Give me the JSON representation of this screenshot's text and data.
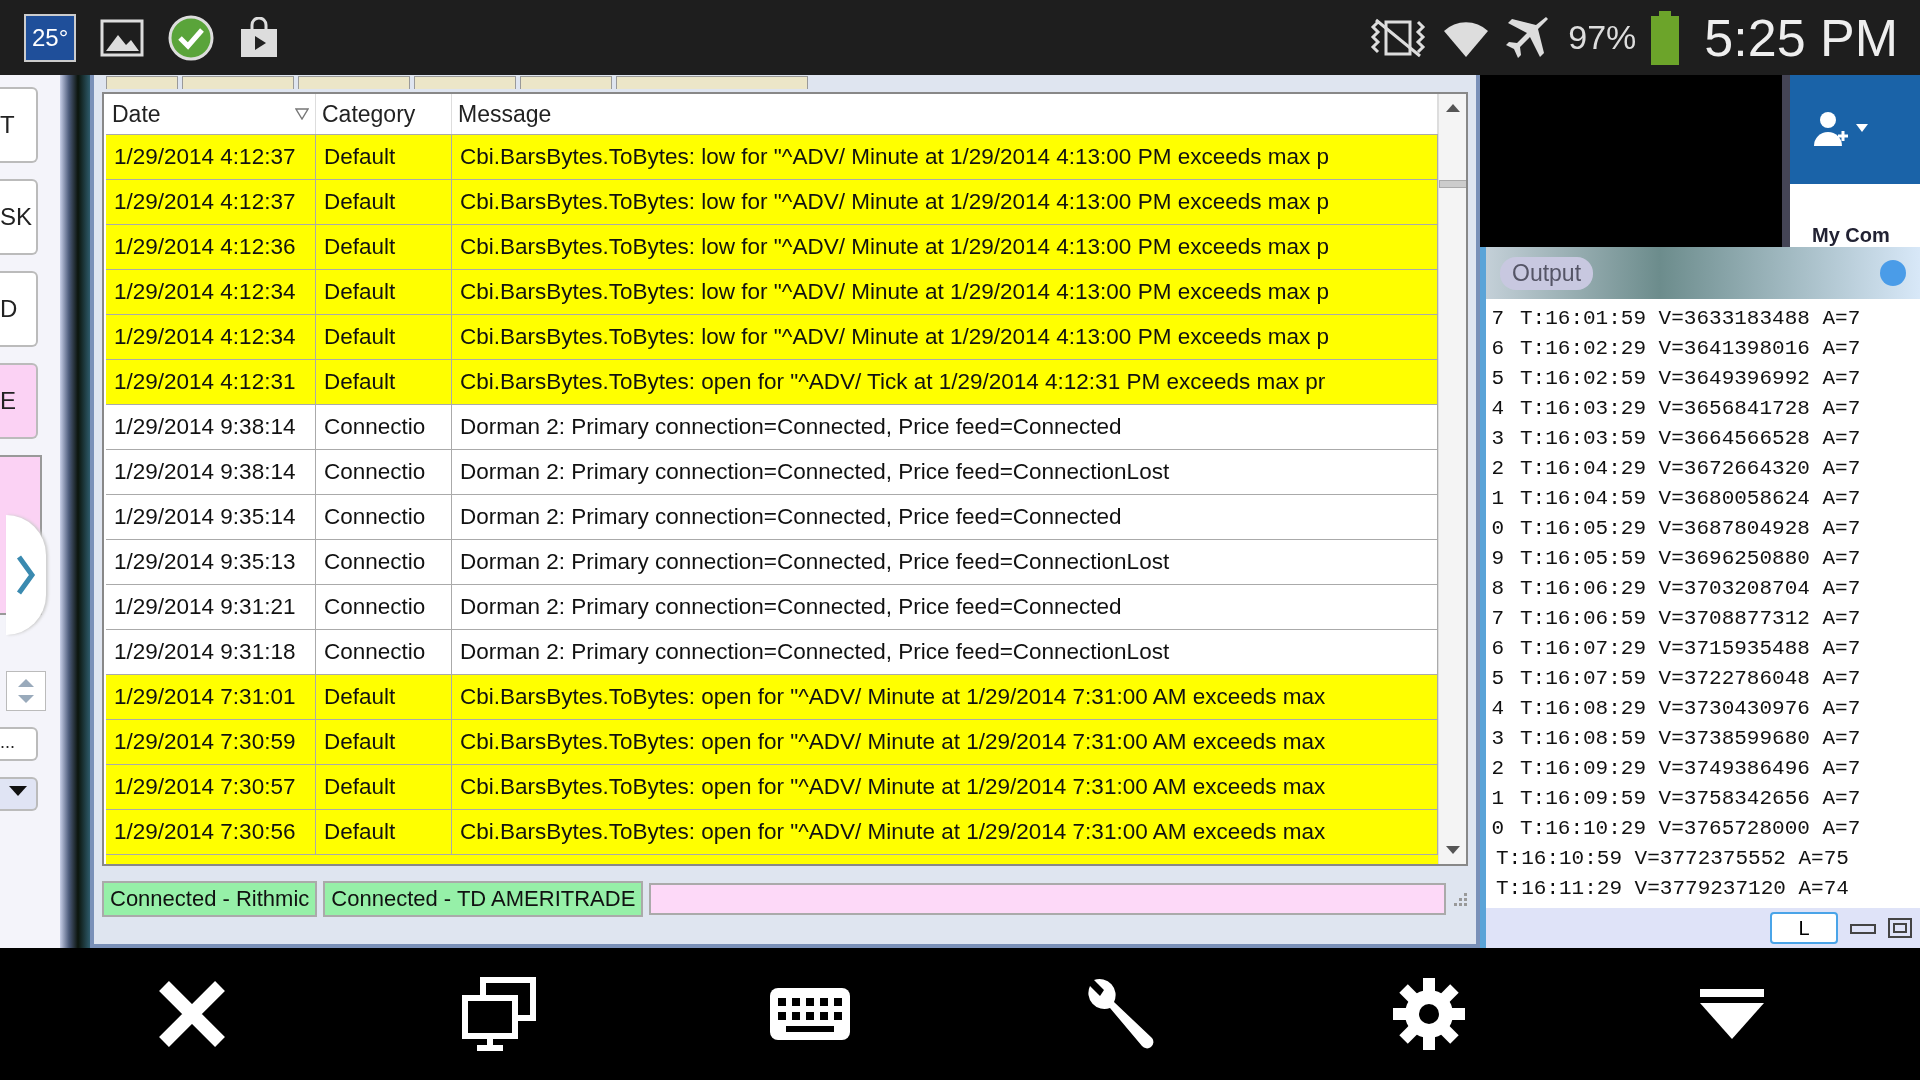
{
  "status_bar": {
    "temperature": "25°",
    "battery_percent": "97%",
    "time": "5:25 PM"
  },
  "left_panel": {
    "buttons": [
      {
        "label": "T",
        "kind": "plain"
      },
      {
        "label": "SK",
        "kind": "plain"
      },
      {
        "label": "D",
        "kind": "plain"
      },
      {
        "label": "E",
        "kind": "pink"
      }
    ],
    "ellipsis": "..."
  },
  "log_table": {
    "columns": [
      "Date",
      "Category",
      "Message"
    ],
    "rows": [
      {
        "date": "1/29/2014 4:12:37",
        "category": "Default",
        "message": "Cbi.BarsBytes.ToBytes: low for \"^ADV/ Minute at 1/29/2014 4:13:00 PM exceeds max p",
        "highlighted": true
      },
      {
        "date": "1/29/2014 4:12:37",
        "category": "Default",
        "message": "Cbi.BarsBytes.ToBytes: low for \"^ADV/ Minute at 1/29/2014 4:13:00 PM exceeds max p",
        "highlighted": true
      },
      {
        "date": "1/29/2014 4:12:36",
        "category": "Default",
        "message": "Cbi.BarsBytes.ToBytes: low for \"^ADV/ Minute at 1/29/2014 4:13:00 PM exceeds max p",
        "highlighted": true
      },
      {
        "date": "1/29/2014 4:12:34",
        "category": "Default",
        "message": "Cbi.BarsBytes.ToBytes: low for \"^ADV/ Minute at 1/29/2014 4:13:00 PM exceeds max p",
        "highlighted": true
      },
      {
        "date": "1/29/2014 4:12:34",
        "category": "Default",
        "message": "Cbi.BarsBytes.ToBytes: low for \"^ADV/ Minute at 1/29/2014 4:13:00 PM exceeds max p",
        "highlighted": true
      },
      {
        "date": "1/29/2014 4:12:31",
        "category": "Default",
        "message": "Cbi.BarsBytes.ToBytes: open for \"^ADV/ Tick at 1/29/2014 4:12:31 PM exceeds max pr",
        "highlighted": true
      },
      {
        "date": "1/29/2014 9:38:14",
        "category": "Connectio",
        "message": "Dorman 2: Primary connection=Connected, Price feed=Connected",
        "highlighted": false
      },
      {
        "date": "1/29/2014 9:38:14",
        "category": "Connectio",
        "message": "Dorman 2: Primary connection=Connected, Price feed=ConnectionLost",
        "highlighted": false
      },
      {
        "date": "1/29/2014 9:35:14",
        "category": "Connectio",
        "message": "Dorman 2: Primary connection=Connected, Price feed=Connected",
        "highlighted": false
      },
      {
        "date": "1/29/2014 9:35:13",
        "category": "Connectio",
        "message": "Dorman 2: Primary connection=Connected, Price feed=ConnectionLost",
        "highlighted": false
      },
      {
        "date": "1/29/2014 9:31:21",
        "category": "Connectio",
        "message": "Dorman 2: Primary connection=Connected, Price feed=Connected",
        "highlighted": false
      },
      {
        "date": "1/29/2014 9:31:18",
        "category": "Connectio",
        "message": "Dorman 2: Primary connection=Connected, Price feed=ConnectionLost",
        "highlighted": false
      },
      {
        "date": "1/29/2014 7:31:01",
        "category": "Default",
        "message": "Cbi.BarsBytes.ToBytes: open for \"^ADV/ Minute at 1/29/2014 7:31:00 AM exceeds max",
        "highlighted": true
      },
      {
        "date": "1/29/2014 7:30:59",
        "category": "Default",
        "message": "Cbi.BarsBytes.ToBytes: open for \"^ADV/ Minute at 1/29/2014 7:31:00 AM exceeds max",
        "highlighted": true
      },
      {
        "date": "1/29/2014 7:30:57",
        "category": "Default",
        "message": "Cbi.BarsBytes.ToBytes: open for \"^ADV/ Minute at 1/29/2014 7:31:00 AM exceeds max",
        "highlighted": true
      },
      {
        "date": "1/29/2014 7:30:56",
        "category": "Default",
        "message": "Cbi.BarsBytes.ToBytes: open for \"^ADV/ Minute at 1/29/2014 7:31:00 AM exceeds max",
        "highlighted": true
      }
    ]
  },
  "connections": [
    "Connected - Rithmic",
    "Connected - TD AMERITRADE"
  ],
  "side_panel": {
    "heading": "My Com"
  },
  "output": {
    "title": "Output",
    "lines": [
      {
        "prefix": "7",
        "text": "T:16:01:59 V=3633183488 A=7"
      },
      {
        "prefix": "6",
        "text": "T:16:02:29 V=3641398016 A=7"
      },
      {
        "prefix": "5",
        "text": "T:16:02:59 V=3649396992 A=7"
      },
      {
        "prefix": "4",
        "text": "T:16:03:29 V=3656841728 A=7"
      },
      {
        "prefix": "3",
        "text": "T:16:03:59 V=3664566528 A=7"
      },
      {
        "prefix": "2",
        "text": "T:16:04:29 V=3672664320 A=7"
      },
      {
        "prefix": "1",
        "text": "T:16:04:59 V=3680058624 A=7"
      },
      {
        "prefix": "0",
        "text": "T:16:05:29 V=3687804928 A=7"
      },
      {
        "prefix": "9",
        "text": "T:16:05:59 V=3696250880 A=7"
      },
      {
        "prefix": "8",
        "text": "T:16:06:29 V=3703208704 A=7"
      },
      {
        "prefix": "7",
        "text": "T:16:06:59 V=3708877312 A=7"
      },
      {
        "prefix": "6",
        "text": "T:16:07:29 V=3715935488 A=7"
      },
      {
        "prefix": "5",
        "text": "T:16:07:59 V=3722786048 A=7"
      },
      {
        "prefix": "4",
        "text": "T:16:08:29 V=3730430976 A=7"
      },
      {
        "prefix": "3",
        "text": "T:16:08:59 V=3738599680 A=7"
      },
      {
        "prefix": "2",
        "text": "T:16:09:29 V=3749386496 A=7"
      },
      {
        "prefix": "1",
        "text": "T:16:09:59 V=3758342656 A=7"
      },
      {
        "prefix": "0",
        "text": "T:16:10:29 V=3765728000 A=7"
      },
      {
        "text": "T:16:10:59 V=3772375552 A=75"
      },
      {
        "text": "T:16:11:29 V=3779237120 A=74"
      }
    ],
    "button": "L"
  }
}
